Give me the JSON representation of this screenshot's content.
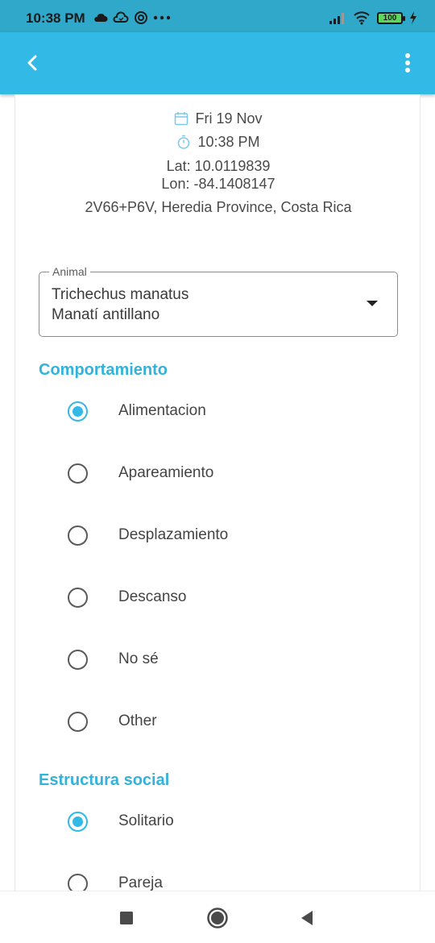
{
  "status_bar": {
    "time": "10:38 PM",
    "battery": "100"
  },
  "app_bar": {
    "back_icon": "chevron-left-icon",
    "menu_icon": "more-vert-icon"
  },
  "meta": {
    "date": "Fri 19 Nov",
    "time": "10:38 PM",
    "lat": "Lat: 10.0119839",
    "lon": "Lon: -84.1408147",
    "address": "2V66+P6V, Heredia Province, Costa Rica"
  },
  "animal_field": {
    "label": "Animal",
    "value_line1": "Trichechus manatus",
    "value_line2": "Manatí antillano"
  },
  "behavior": {
    "title": "Comportamiento",
    "options": [
      {
        "label": "Alimentacion",
        "checked": true
      },
      {
        "label": "Apareamiento",
        "checked": false
      },
      {
        "label": "Desplazamiento",
        "checked": false
      },
      {
        "label": "Descanso",
        "checked": false
      },
      {
        "label": "No sé",
        "checked": false
      },
      {
        "label": "Other",
        "checked": false
      }
    ]
  },
  "social": {
    "title": "Estructura social",
    "options": [
      {
        "label": "Solitario",
        "checked": true
      },
      {
        "label": "Pareja",
        "checked": false
      }
    ]
  },
  "colors": {
    "app_bar": "#33b9e5",
    "status_bar": "#2fa8c9",
    "accent": "#33b2dc"
  }
}
